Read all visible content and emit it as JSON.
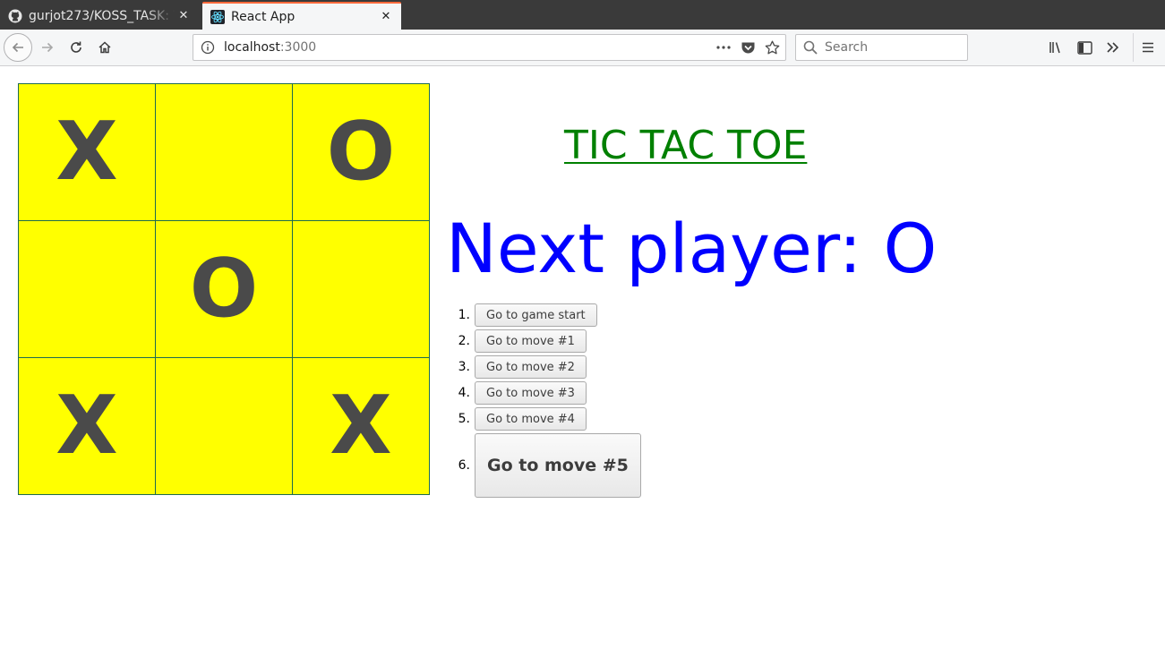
{
  "browser": {
    "tabs": [
      {
        "title": "gurjot273/KOSS_TASK: T",
        "icon": "github-icon",
        "active": false
      },
      {
        "title": "React App",
        "icon": "react-icon",
        "active": true
      }
    ],
    "url": {
      "host": "localhost",
      "port": ":3000"
    },
    "search_placeholder": "Search"
  },
  "game": {
    "title": "TIC TAC TOE",
    "status": "Next player: O",
    "board": [
      "X",
      "",
      "O",
      "",
      "O",
      "",
      "X",
      "",
      "X"
    ],
    "colors": {
      "board": "#ffff00",
      "title": "#008000",
      "status": "#0000ff",
      "marks": "#4a4a4a"
    },
    "moves": [
      {
        "number": "1.",
        "label": "Go to game start"
      },
      {
        "number": "2.",
        "label": "Go to move #1"
      },
      {
        "number": "3.",
        "label": "Go to move #2"
      },
      {
        "number": "4.",
        "label": "Go to move #3"
      },
      {
        "number": "5.",
        "label": "Go to move #4"
      },
      {
        "number": "6.",
        "label": "Go to move #5"
      }
    ]
  }
}
